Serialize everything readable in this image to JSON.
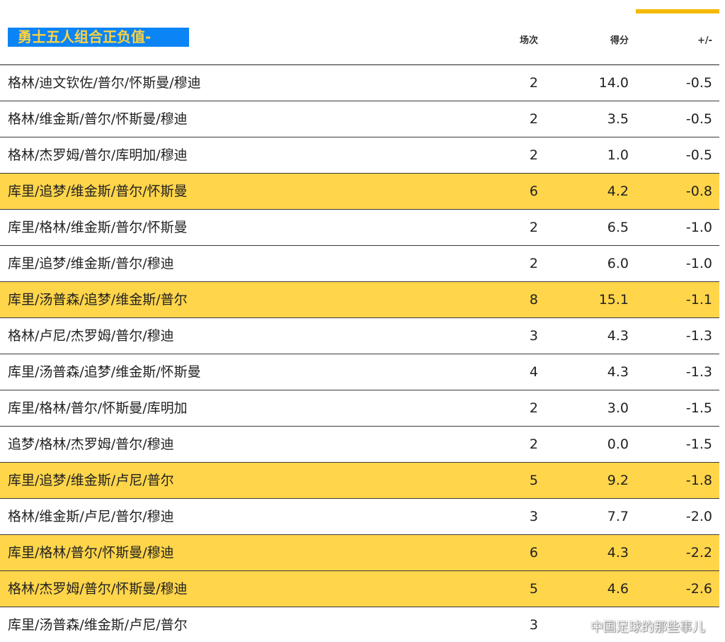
{
  "title": "勇士五人组合正负值-",
  "headers": {
    "games": "场次",
    "points": "得分",
    "plus_minus": "+/-"
  },
  "colors": {
    "title_bg": "#0b84f5",
    "title_text": "#ffd23f",
    "highlight": "#ffd54a",
    "accent": "#f5b900"
  },
  "rows": [
    {
      "lineup": "格林/迪文钦佐/普尔/怀斯曼/穆迪",
      "games": "2",
      "points": "14.0",
      "pm": "-0.5",
      "highlight": false
    },
    {
      "lineup": "格林/维金斯/普尔/怀斯曼/穆迪",
      "games": "2",
      "points": "3.5",
      "pm": "-0.5",
      "highlight": false
    },
    {
      "lineup": "格林/杰罗姆/普尔/库明加/穆迪",
      "games": "2",
      "points": "1.0",
      "pm": "-0.5",
      "highlight": false
    },
    {
      "lineup": "库里/追梦/维金斯/普尔/怀斯曼",
      "games": "6",
      "points": "4.2",
      "pm": "-0.8",
      "highlight": true
    },
    {
      "lineup": "库里/格林/维金斯/普尔/怀斯曼",
      "games": "2",
      "points": "6.5",
      "pm": "-1.0",
      "highlight": false
    },
    {
      "lineup": "库里/追梦/维金斯/普尔/穆迪",
      "games": "2",
      "points": "6.0",
      "pm": "-1.0",
      "highlight": false
    },
    {
      "lineup": "库里/汤普森/追梦/维金斯/普尔",
      "games": "8",
      "points": "15.1",
      "pm": "-1.1",
      "highlight": true
    },
    {
      "lineup": "格林/卢尼/杰罗姆/普尔/穆迪",
      "games": "3",
      "points": "4.3",
      "pm": "-1.3",
      "highlight": false
    },
    {
      "lineup": "库里/汤普森/追梦/维金斯/怀斯曼",
      "games": "4",
      "points": "4.3",
      "pm": "-1.3",
      "highlight": false
    },
    {
      "lineup": "库里/格林/普尔/怀斯曼/库明加",
      "games": "2",
      "points": "3.0",
      "pm": "-1.5",
      "highlight": false
    },
    {
      "lineup": "追梦/格林/杰罗姆/普尔/穆迪",
      "games": "2",
      "points": "0.0",
      "pm": "-1.5",
      "highlight": false
    },
    {
      "lineup": "库里/追梦/维金斯/卢尼/普尔",
      "games": "5",
      "points": "9.2",
      "pm": "-1.8",
      "highlight": true
    },
    {
      "lineup": "格林/维金斯/卢尼/普尔/穆迪",
      "games": "3",
      "points": "7.7",
      "pm": "-2.0",
      "highlight": false
    },
    {
      "lineup": "库里/格林/普尔/怀斯曼/穆迪",
      "games": "6",
      "points": "4.3",
      "pm": "-2.2",
      "highlight": true
    },
    {
      "lineup": "格林/杰罗姆/普尔/怀斯曼/穆迪",
      "games": "5",
      "points": "4.6",
      "pm": "-2.6",
      "highlight": true
    },
    {
      "lineup": "库里/汤普森/维金斯/卢尼/普尔",
      "games": "3",
      "points": "",
      "pm": "",
      "highlight": false
    }
  ],
  "watermark": "中国足球的那些事儿"
}
